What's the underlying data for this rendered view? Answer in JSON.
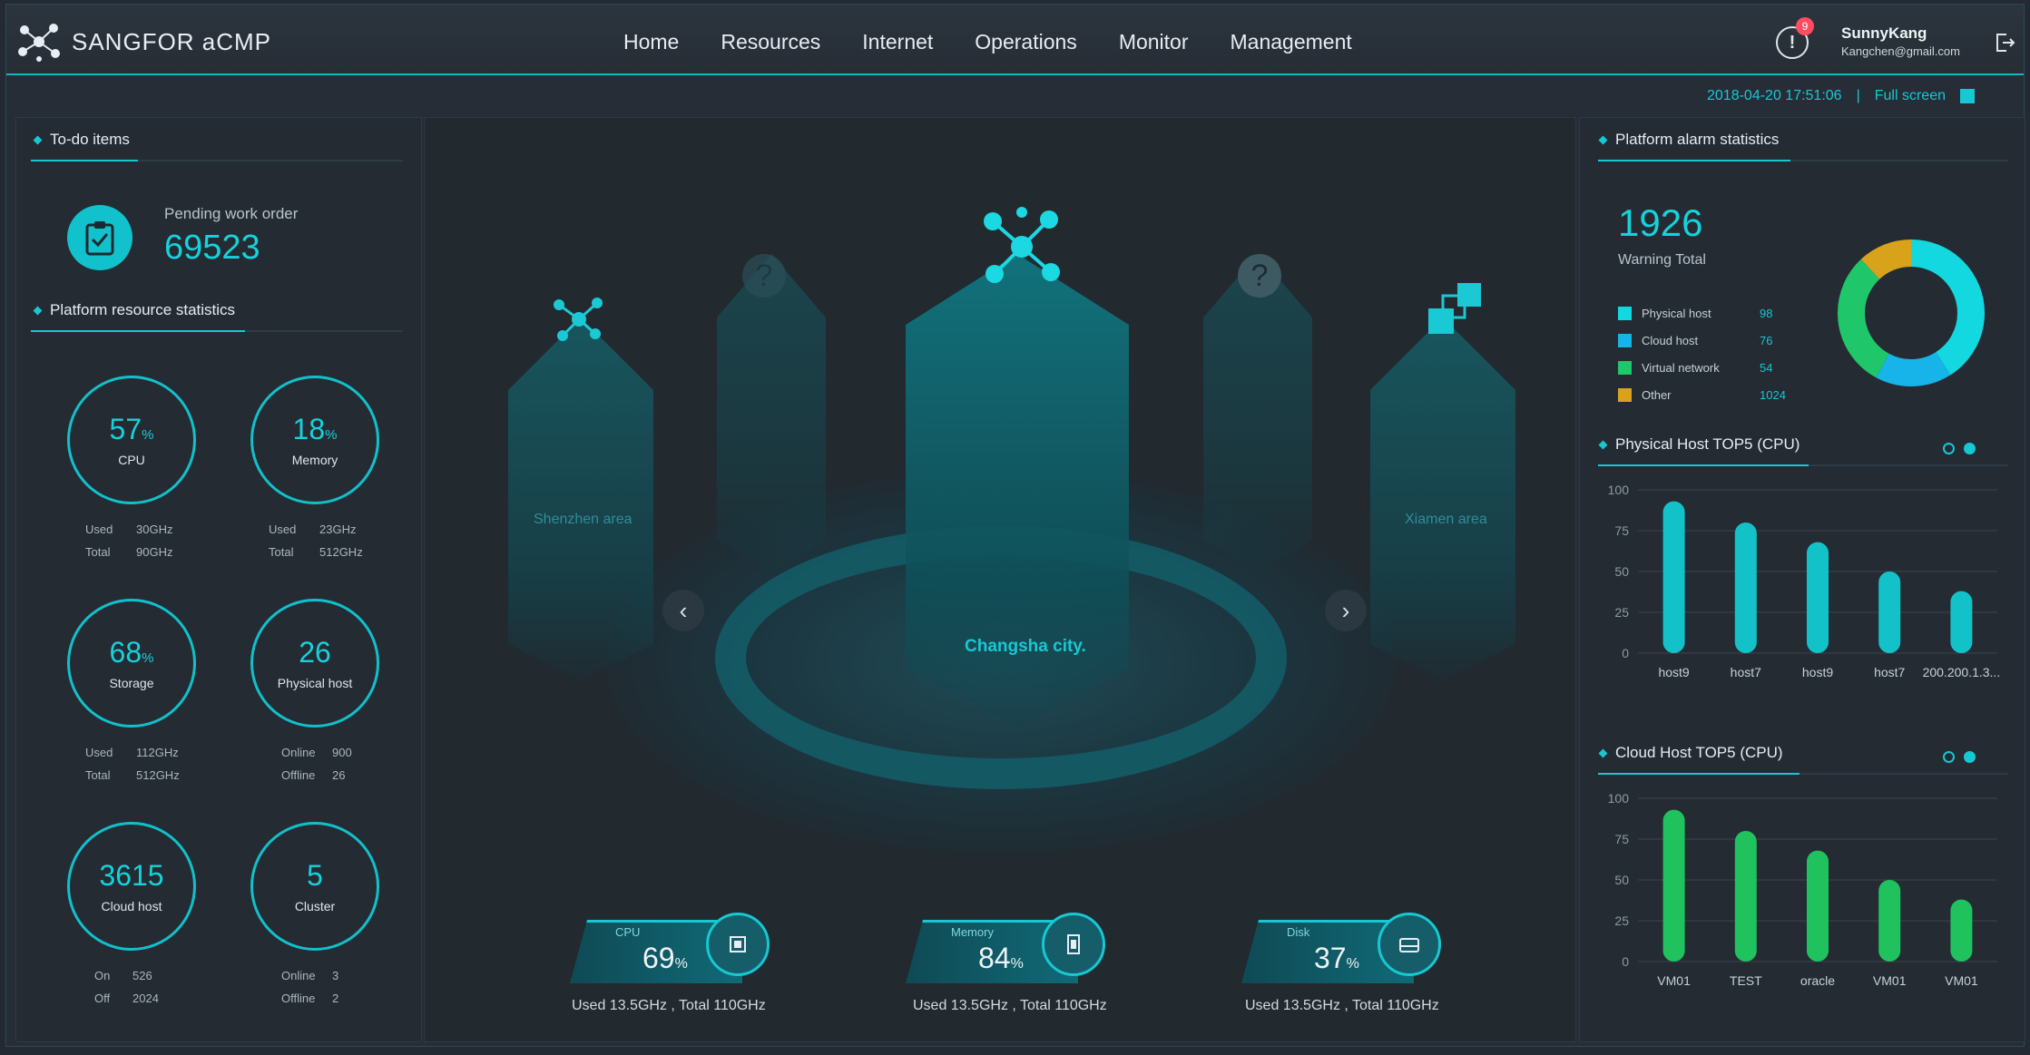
{
  "app": {
    "brand": "SANGFOR aCMP"
  },
  "nav": [
    "Home",
    "Resources",
    "Internet",
    "Operations",
    "Monitor",
    "Management"
  ],
  "notifications": {
    "badge": "9"
  },
  "user": {
    "name": "SunnyKang",
    "email": "Kangchen@gmail.com"
  },
  "meta": {
    "datetime": "2018-04-20 17:51:06",
    "separator": "|",
    "fullscreen": "Full screen"
  },
  "todo": {
    "title": "To-do items",
    "label": "Pending work order",
    "value": "69523"
  },
  "resources": {
    "title": "Platform resource statistics",
    "rings": [
      {
        "value": "57",
        "unit": "%",
        "label": "CPU",
        "rows": [
          [
            "Used",
            "30GHz"
          ],
          [
            "Total",
            "90GHz"
          ]
        ]
      },
      {
        "value": "18",
        "unit": "%",
        "label": "Memory",
        "rows": [
          [
            "Used",
            "23GHz"
          ],
          [
            "Total",
            "512GHz"
          ]
        ]
      },
      {
        "value": "68",
        "unit": "%",
        "label": "Storage",
        "rows": [
          [
            "Used",
            "112GHz"
          ],
          [
            "Total",
            "512GHz"
          ]
        ]
      },
      {
        "value": "26",
        "unit": "",
        "label": "Physical host",
        "rows": [
          [
            "Online",
            "900"
          ],
          [
            "Offline",
            "26"
          ]
        ]
      },
      {
        "value": "3615",
        "unit": "",
        "label": "Cloud host",
        "rows": [
          [
            "On",
            "526"
          ],
          [
            "Off",
            "2024"
          ]
        ]
      },
      {
        "value": "5",
        "unit": "",
        "label": "Cluster",
        "rows": [
          [
            "Online",
            "3"
          ],
          [
            "Offline",
            "2"
          ]
        ]
      }
    ]
  },
  "center": {
    "areas": [
      "Shenzhen area",
      "Xiamen area"
    ],
    "city": "Changsha city.",
    "gauges": [
      {
        "label": "CPU",
        "value": "69",
        "unit": "%",
        "sub": "Used 13.5GHz , Total 110GHz"
      },
      {
        "label": "Memory",
        "value": "84",
        "unit": "%",
        "sub": "Used 13.5GHz , Total 110GHz"
      },
      {
        "label": "Disk",
        "value": "37",
        "unit": "%",
        "sub": "Used 13.5GHz , Total 110GHz"
      }
    ]
  },
  "alarm": {
    "title": "Platform alarm statistics",
    "total": "1926",
    "total_label": "Warning Total",
    "items": [
      {
        "name": "Physical host",
        "value": "98",
        "color": "#14d8e0"
      },
      {
        "name": "Cloud host",
        "value": "76",
        "color": "#16b4e8"
      },
      {
        "name": "Virtual network",
        "value": "54",
        "color": "#1fc76a"
      },
      {
        "name": "Other",
        "value": "1024",
        "color": "#d8a21b"
      }
    ]
  },
  "chart_data": [
    {
      "type": "bar",
      "title": "Physical Host TOP5 (CPU)",
      "categories": [
        "host9",
        "host7",
        "host9",
        "host7",
        "200.200.1.3..."
      ],
      "values": [
        93,
        80,
        68,
        50,
        38
      ],
      "ylim": [
        0,
        100
      ],
      "yticks": [
        "100",
        "75",
        "50",
        "25",
        "0"
      ],
      "color": "#13c2c9"
    },
    {
      "type": "bar",
      "title": "Cloud Host TOP5 (CPU)",
      "categories": [
        "VM01",
        "TEST",
        "oracle",
        "VM01",
        "VM01"
      ],
      "values": [
        93,
        80,
        68,
        50,
        38
      ],
      "ylim": [
        0,
        100
      ],
      "yticks": [
        "100",
        "75",
        "50",
        "25",
        "0"
      ],
      "color": "#1fc25d"
    },
    {
      "type": "pie",
      "title": "",
      "categories": [
        "Physical host",
        "Cloud host",
        "Virtual network",
        "Other"
      ],
      "values": [
        98,
        76,
        54,
        1024
      ],
      "note": "donut"
    }
  ]
}
